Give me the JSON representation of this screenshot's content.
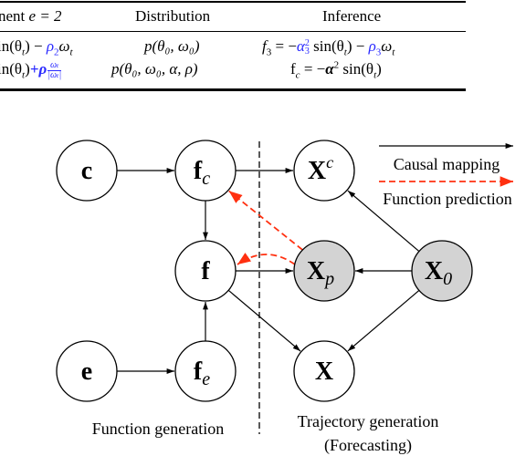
{
  "table": {
    "header": {
      "col1": "nent ",
      "col1_math": "e = 2",
      "col2": "Distribution",
      "col3": "Inference"
    },
    "rows": [
      {
        "col1_prefix": "in(θ",
        "col1_sub": "t",
        "col1_mid": ") − ",
        "col1_blue": "ρ",
        "col1_blue_sub": "2",
        "col1_tail": "ω",
        "col1_tail_sub": "t",
        "col2": "p(θ₀, ω₀)",
        "col3_lhs": "f",
        "col3_lhs_sub": "3",
        "col3_eq": " = −",
        "col3_blue": "α",
        "col3_blue_sup": "2",
        "col3_blue_sub": "3",
        "col3_mid": " sin(θ",
        "col3_mid_sub": "t",
        "col3_mid2": ") − ",
        "col3_blue2": "ρ",
        "col3_blue2_sub": "3",
        "col3_tail": "ω",
        "col3_tail_sub": "t"
      },
      {
        "col1_prefix": "in(θ",
        "col1_sub": "t",
        "col1_mid": ")",
        "col1_blue": "+ρ",
        "col1_frac_num": "ωₜ",
        "col1_frac_den": "|ωₜ|",
        "col2": "p(θ₀, ω₀, α, ρ)",
        "col3_lhs": "f",
        "col3_lhs_sub": "c",
        "col3_eq": " = −",
        "col3_bold": "α",
        "col3_sup": "2",
        "col3_tail": " sin(θ",
        "col3_tail_sub": "t",
        "col3_end": ")"
      }
    ]
  },
  "diagram": {
    "nodes": [
      {
        "id": "c",
        "label": "c",
        "sub": "",
        "sup": "",
        "shaded": false
      },
      {
        "id": "fc",
        "label": "f",
        "sub": "c",
        "sup": "",
        "shaded": false
      },
      {
        "id": "f",
        "label": "f",
        "sub": "",
        "sup": "",
        "shaded": false
      },
      {
        "id": "e",
        "label": "e",
        "sub": "",
        "sup": "",
        "shaded": false
      },
      {
        "id": "fe",
        "label": "f",
        "sub": "e",
        "sup": "",
        "shaded": false
      },
      {
        "id": "Xc",
        "label": "X",
        "sub": "",
        "sup": "c",
        "shaded": false
      },
      {
        "id": "Xp",
        "label": "X",
        "sub": "p",
        "sup": "",
        "shaded": true
      },
      {
        "id": "X0",
        "label": "X",
        "sub": "0",
        "sup": "",
        "shaded": true
      },
      {
        "id": "X",
        "label": "X",
        "sub": "",
        "sup": "",
        "shaded": false
      }
    ],
    "edges": [
      {
        "from": "c",
        "to": "fc",
        "type": "causal"
      },
      {
        "from": "fc",
        "to": "f",
        "type": "causal"
      },
      {
        "from": "fc",
        "to": "Xc",
        "type": "causal"
      },
      {
        "from": "e",
        "to": "fe",
        "type": "causal"
      },
      {
        "from": "fe",
        "to": "f",
        "type": "causal"
      },
      {
        "from": "f",
        "to": "Xp",
        "type": "causal"
      },
      {
        "from": "f",
        "to": "X",
        "type": "causal"
      },
      {
        "from": "X0",
        "to": "Xc",
        "type": "causal"
      },
      {
        "from": "X0",
        "to": "Xp",
        "type": "causal"
      },
      {
        "from": "X0",
        "to": "X",
        "type": "causal"
      },
      {
        "from": "Xp",
        "to": "fc",
        "type": "prediction"
      },
      {
        "from": "Xp",
        "to": "f",
        "type": "prediction"
      }
    ],
    "legend": {
      "causal_label": "Causal mapping",
      "prediction_label": "Function prediction"
    },
    "captions": {
      "left": "Function generation",
      "right_line1": "Trajectory generation",
      "right_line2": "(Forecasting)"
    },
    "colors": {
      "causal": "#000000",
      "prediction": "#ff3010",
      "shaded_fill": "#d3d3d3",
      "unshaded_fill": "#ffffff"
    }
  }
}
